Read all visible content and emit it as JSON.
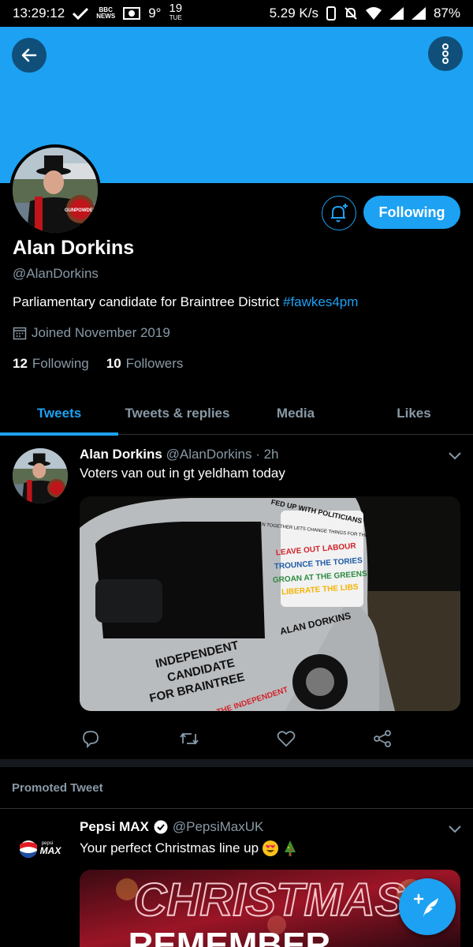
{
  "status_bar": {
    "time": "13:29:12",
    "news_label": "BBC NEWS",
    "temperature": "9°",
    "date_day": "19",
    "date_weekday": "TUE",
    "network_speed": "5.29 K/s",
    "battery": "87%"
  },
  "profile": {
    "display_name": "Alan Dorkins",
    "handle": "@AlanDorkins",
    "bio_text": "Parliamentary candidate for Braintree District ",
    "bio_hashtag": "#fawkes4pm",
    "joined": "Joined November 2019",
    "following_count": "12",
    "following_label": "Following",
    "followers_count": "10",
    "followers_label": "Followers",
    "follow_button": "Following",
    "avatar_badge_text": "GUNPOWDER"
  },
  "tabs": [
    {
      "label": "Tweets",
      "active": true
    },
    {
      "label": "Tweets & replies",
      "active": false
    },
    {
      "label": "Media",
      "active": false
    },
    {
      "label": "Likes",
      "active": false
    }
  ],
  "tweet": {
    "name": "Alan Dorkins",
    "handle_time": "@AlanDorkins · 2h",
    "text": "Voters van out in gt yeldham today",
    "van_lines": {
      "header": "FED UP WITH POLITICIANS",
      "sub": "THEN TOGETHER LETS CHANGE THINGS FOR THE BETTER",
      "l1": "LEAVE OUT LABOUR",
      "l2": "TROUNCE THE TORIES",
      "l3": "GROAN AT THE GREENS",
      "l4": "LIBERATE THE LIBS",
      "name": "ALAN DORKINS",
      "side1": "INDEPENDENT",
      "side2": "CANDIDATE",
      "side3": "FOR BRAINTREE",
      "skirt": "THE INDEPENDENT"
    }
  },
  "promoted": {
    "label": "Promoted Tweet",
    "name": "Pepsi MAX",
    "handle": "@PepsiMaxUK",
    "text": "Your perfect Christmas line up",
    "logo_small": "pepsi",
    "logo_big": "MAX",
    "banner_line1": "CHRISTMAS",
    "banner_line2": "REMEMBER"
  },
  "colors": {
    "accent": "#1da1f2",
    "background": "#000000",
    "secondary_text": "#8899a6"
  }
}
